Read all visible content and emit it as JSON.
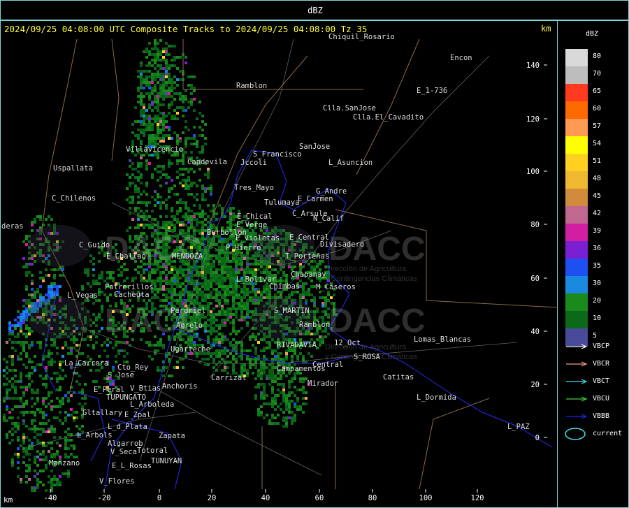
{
  "window": {
    "title": "dBZ"
  },
  "header": {
    "text": "2024/09/25 04:08:00 UTC Composite Tracks to 2024/09/25 04:08:00 Tz 35",
    "km_right": "km",
    "km_bottom": "km"
  },
  "axes": {
    "x_ticks": [
      "-40",
      "-20",
      "0",
      "20",
      "40",
      "60",
      "80",
      "100",
      "120"
    ],
    "y_ticks": [
      "140",
      "120",
      "100",
      "80",
      "60",
      "40",
      "20",
      "0"
    ]
  },
  "legend": {
    "title": "dBZ",
    "colors": [
      {
        "label": "80",
        "color": "#d9d9d9"
      },
      {
        "label": "70",
        "color": "#bdbdbd"
      },
      {
        "label": "65",
        "color": "#ff3a1f"
      },
      {
        "label": "60",
        "color": "#ff6a00"
      },
      {
        "label": "57",
        "color": "#ff9a55"
      },
      {
        "label": "54",
        "color": "#ffff00"
      },
      {
        "label": "51",
        "color": "#ffd020"
      },
      {
        "label": "48",
        "color": "#f0b830"
      },
      {
        "label": "45",
        "color": "#d28a3c"
      },
      {
        "label": "42",
        "color": "#c06890"
      },
      {
        "label": "39",
        "color": "#d21ea0"
      },
      {
        "label": "36",
        "color": "#7a1fd2"
      },
      {
        "label": "35",
        "color": "#1e4ff0"
      },
      {
        "label": "30",
        "color": "#1a8ae0"
      },
      {
        "label": "20",
        "color": "#1a8a1a"
      },
      {
        "label": "10",
        "color": "#0a6a1a"
      },
      {
        "label": "5",
        "color": "#4a4a9a"
      }
    ],
    "tracks": [
      {
        "label": "VBCP",
        "color": "#ffffff"
      },
      {
        "label": "VBCR",
        "color": "#f0a080"
      },
      {
        "label": "VBCT",
        "color": "#40e0e0"
      },
      {
        "label": "VBCU",
        "color": "#40d040"
      },
      {
        "label": "VBBB",
        "color": "#2020ff"
      }
    ],
    "current": {
      "label": "current",
      "color": "#40e0f0"
    }
  },
  "watermark": {
    "brand": "DACC",
    "line1": "Dirección de Agricultura",
    "line2": "y Contingencias Climáticas"
  },
  "places": [
    {
      "name": "Ramblon"
    },
    {
      "name": "Encon"
    },
    {
      "name": "E_1-736"
    },
    {
      "name": "Clla.SanJose"
    },
    {
      "name": "Clla.El_Cavadito"
    },
    {
      "name": "SanJose"
    },
    {
      "name": "S_Francisco"
    },
    {
      "name": "Jccoli"
    },
    {
      "name": "L_Asuncion"
    },
    {
      "name": "Villavicencio"
    },
    {
      "name": "Uspallata"
    },
    {
      "name": "Capdevila"
    },
    {
      "name": "Tres_Mayo"
    },
    {
      "name": "G_Andre"
    },
    {
      "name": "E_Carmen"
    },
    {
      "name": "Tulumaya"
    },
    {
      "name": "C_Chilenos"
    },
    {
      "name": "E_Chical"
    },
    {
      "name": "C_Arsule"
    },
    {
      "name": "E_Verge"
    },
    {
      "name": "N_Calif"
    },
    {
      "name": "Borbollon"
    },
    {
      "name": "C_Guido"
    },
    {
      "name": "P_Hierro"
    },
    {
      "name": "E_Violetas"
    },
    {
      "name": "E_Central"
    },
    {
      "name": "Divisadero"
    },
    {
      "name": "E_Challao"
    },
    {
      "name": "MENDOZA"
    },
    {
      "name": "T_Porteñas"
    },
    {
      "name": "Chapanay"
    },
    {
      "name": "L_Bolivar"
    },
    {
      "name": "Potrerillos"
    },
    {
      "name": "Cacheuta"
    },
    {
      "name": "Chimbas"
    },
    {
      "name": "M_Caseros"
    },
    {
      "name": "L_Vegas"
    },
    {
      "name": "Perdriel"
    },
    {
      "name": "S_MARTIN"
    },
    {
      "name": "Agrelo"
    },
    {
      "name": "Ramblon"
    },
    {
      "name": "Lomas_Blancas"
    },
    {
      "name": "12_Oct"
    },
    {
      "name": "Ugarteche"
    },
    {
      "name": "RIVADAVIA"
    },
    {
      "name": "S_ROSA"
    },
    {
      "name": "La_Carrera"
    },
    {
      "name": "Central"
    },
    {
      "name": "Cto_Rey"
    },
    {
      "name": "Campamentos"
    },
    {
      "name": "S_Jose"
    },
    {
      "name": "Catitas"
    },
    {
      "name": "Carrizal"
    },
    {
      "name": "Mirador"
    },
    {
      "name": "E_Peral"
    },
    {
      "name": "V_Btias"
    },
    {
      "name": "Anchoris"
    },
    {
      "name": "TUPUNGATO"
    },
    {
      "name": "L_Dormida"
    },
    {
      "name": "L_Arboleda"
    },
    {
      "name": "Gltallary"
    },
    {
      "name": "E_Zpal"
    },
    {
      "name": "L_d_Plata"
    },
    {
      "name": "L_PAZ"
    },
    {
      "name": "L_Arbols"
    },
    {
      "name": "Zapata"
    },
    {
      "name": "Algarrob"
    },
    {
      "name": "V_Seca"
    },
    {
      "name": "Totoral"
    },
    {
      "name": "TUNUYAN"
    },
    {
      "name": "Manzano"
    },
    {
      "name": "E_L_Rosas"
    },
    {
      "name": "V_Flores"
    },
    {
      "name": "deras"
    },
    {
      "name": "Chiquil_Rosario"
    }
  ]
}
